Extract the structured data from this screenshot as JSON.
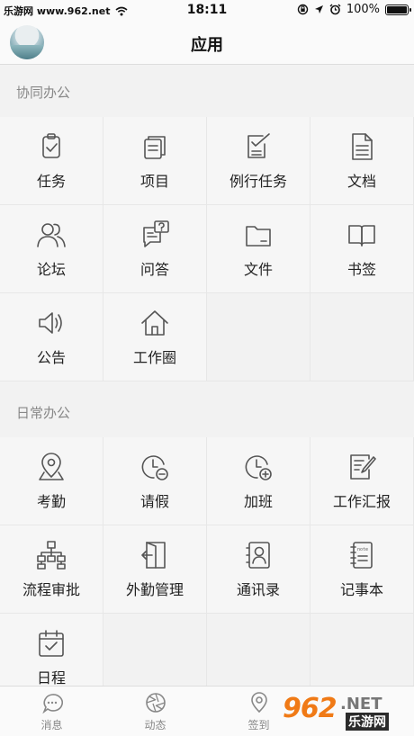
{
  "status_bar": {
    "carrier": "乐游网 www.962.net",
    "time": "18:11",
    "battery": "100%"
  },
  "nav": {
    "title": "应用"
  },
  "sections": [
    {
      "title": "协同办公",
      "items": [
        {
          "label": "任务",
          "icon": "clipboard-check-icon"
        },
        {
          "label": "项目",
          "icon": "stacked-cards-icon"
        },
        {
          "label": "例行任务",
          "icon": "checklist-icon"
        },
        {
          "label": "文档",
          "icon": "document-icon"
        },
        {
          "label": "论坛",
          "icon": "users-icon"
        },
        {
          "label": "问答",
          "icon": "chat-question-icon"
        },
        {
          "label": "文件",
          "icon": "folder-icon"
        },
        {
          "label": "书签",
          "icon": "book-icon"
        },
        {
          "label": "公告",
          "icon": "speaker-icon"
        },
        {
          "label": "工作圈",
          "icon": "home-icon"
        }
      ]
    },
    {
      "title": "日常办公",
      "items": [
        {
          "label": "考勤",
          "icon": "location-pin-icon"
        },
        {
          "label": "请假",
          "icon": "clock-minus-icon"
        },
        {
          "label": "加班",
          "icon": "clock-plus-icon"
        },
        {
          "label": "工作汇报",
          "icon": "edit-report-icon"
        },
        {
          "label": "流程审批",
          "icon": "org-chart-icon"
        },
        {
          "label": "外勤管理",
          "icon": "door-exit-icon"
        },
        {
          "label": "通讯录",
          "icon": "contacts-icon"
        },
        {
          "label": "记事本",
          "icon": "notebook-icon"
        },
        {
          "label": "日程",
          "icon": "calendar-icon"
        }
      ]
    }
  ],
  "tabs": [
    {
      "label": "消息",
      "icon": "message-icon"
    },
    {
      "label": "动态",
      "icon": "aperture-icon"
    },
    {
      "label": "签到",
      "icon": "location-pin-icon"
    }
  ],
  "watermark": {
    "num": "962",
    "net": ".NET",
    "cn": "乐游网"
  }
}
